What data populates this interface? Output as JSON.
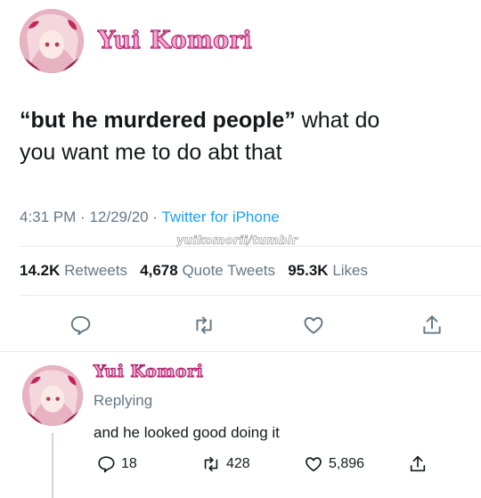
{
  "tweet": {
    "author": {
      "display_name": "Yui Komori"
    },
    "text_quote": "“but he murdered people”",
    "text_rest_line1": " what do",
    "text_line2": "you want me to do abt that",
    "time": "4:31 PM",
    "date": "12/29/20",
    "separator": "·",
    "source": "Twitter for iPhone",
    "watermark": "yuikomorii/tumblr",
    "stats": {
      "retweets_count": "14.2K",
      "retweets_label": "Retweets",
      "quotes_count": "4,678",
      "quotes_label": "Quote Tweets",
      "likes_count": "95.3K",
      "likes_label": "Likes"
    },
    "actions": [
      "reply-icon",
      "retweet-icon",
      "like-icon",
      "share-icon"
    ]
  },
  "reply": {
    "author": {
      "display_name": "Yui Komori"
    },
    "replying_label": "Replying",
    "text": "and he looked good doing it",
    "reply_count": "18",
    "retweet_count": "428",
    "like_count": "5,896"
  },
  "colors": {
    "link": "#1da1f2",
    "muted": "#657786",
    "name_fill": "#f7a7d6",
    "name_outline": "#b0286e"
  }
}
